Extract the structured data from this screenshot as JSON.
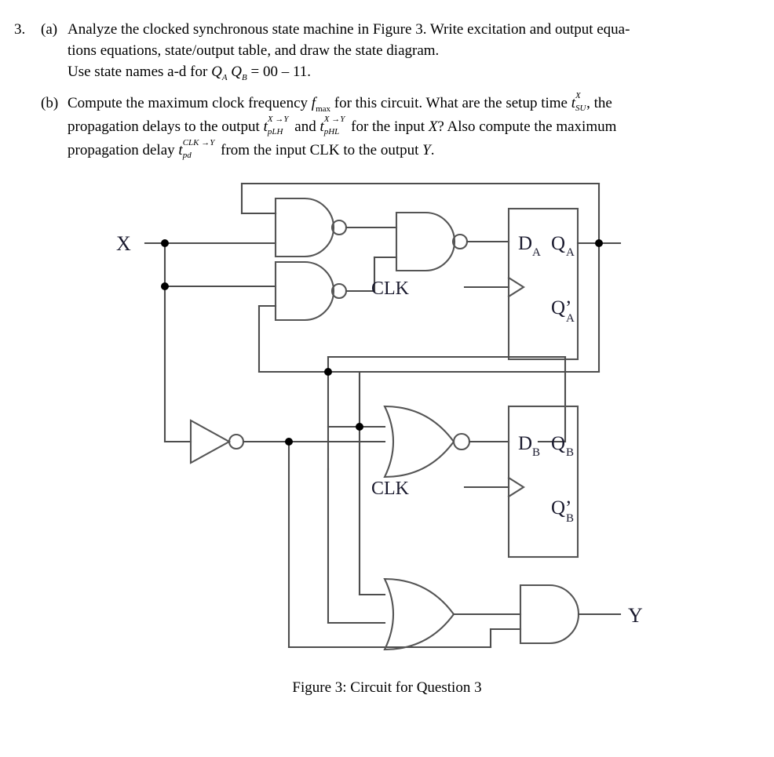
{
  "question": {
    "number": "3.",
    "parts": [
      {
        "label": "(a)",
        "line1_a": "Analyze the clocked synchronous state machine in Figure 3. Write excitation and output equa-",
        "line2": "tions equations, state/output table, and draw the state diagram.",
        "line3_a": "Use state names a-d for ",
        "line3_q_a": "Q",
        "line3_q_a_sub": "A",
        "line3_q_b": "Q",
        "line3_q_b_sub": "B",
        "line3_b": " = 00 – 11."
      },
      {
        "label": "(b)",
        "seg1": "Compute the maximum clock frequency ",
        "f_sym": "f",
        "f_sub": "max",
        "seg2": " for this circuit. What are the setup time ",
        "t1_base": "t",
        "t1_sup": "X",
        "t1_sub": "SU",
        "seg3": ", the",
        "seg4": "propagation delays to the output ",
        "t2_base": "t",
        "t2_sup": "X →Y",
        "t2_sub": "pLH",
        "seg5": " and ",
        "t3_base": "t",
        "t3_sup": "X →Y",
        "t3_sub": "pHL",
        "seg6": " for the input ",
        "x_var": "X",
        "seg7": "? Also compute the maximum",
        "seg8": "propagation delay ",
        "t4_base": "t",
        "t4_sup": "CLK →Y",
        "t4_sub": "pd",
        "seg9": " from the input CLK to the output ",
        "y_var": "Y",
        "seg10": "."
      }
    ]
  },
  "figure": {
    "caption": "Figure 3: Circuit for Question 3",
    "labels": {
      "input_x": "X",
      "clk_a": "CLK",
      "clk_b": "CLK",
      "output_y": "Y",
      "ff_a_d": "D",
      "ff_a_d_sub": "A",
      "ff_a_q": "Q",
      "ff_a_q_sub": "A",
      "ff_a_qn": "Q’",
      "ff_a_qn_sub": "A",
      "ff_b_d": "D",
      "ff_b_d_sub": "B",
      "ff_b_q": "Q",
      "ff_b_q_sub": "B",
      "ff_b_qn": "Q’",
      "ff_b_qn_sub": "B"
    },
    "colors": {
      "wire": "#4d4d4d",
      "gate_stroke": "#555555",
      "text": "#1a1a2e",
      "background": "#ffffff"
    },
    "components": [
      {
        "name": "nand-gate-1",
        "type": "NAND",
        "inputs": 2
      },
      {
        "name": "nand-gate-2",
        "type": "NAND",
        "inputs": 2
      },
      {
        "name": "nand-gate-3",
        "type": "NAND",
        "inputs": 2
      },
      {
        "name": "inverter-gate",
        "type": "NOT",
        "inputs": 1
      },
      {
        "name": "nor-gate",
        "type": "NOR",
        "inputs": 2
      },
      {
        "name": "or-gate",
        "type": "OR",
        "inputs": 2
      },
      {
        "name": "and-gate",
        "type": "AND",
        "inputs": 2
      },
      {
        "name": "flip-flop-a",
        "type": "D-FF"
      },
      {
        "name": "flip-flop-b",
        "type": "D-FF"
      }
    ]
  }
}
